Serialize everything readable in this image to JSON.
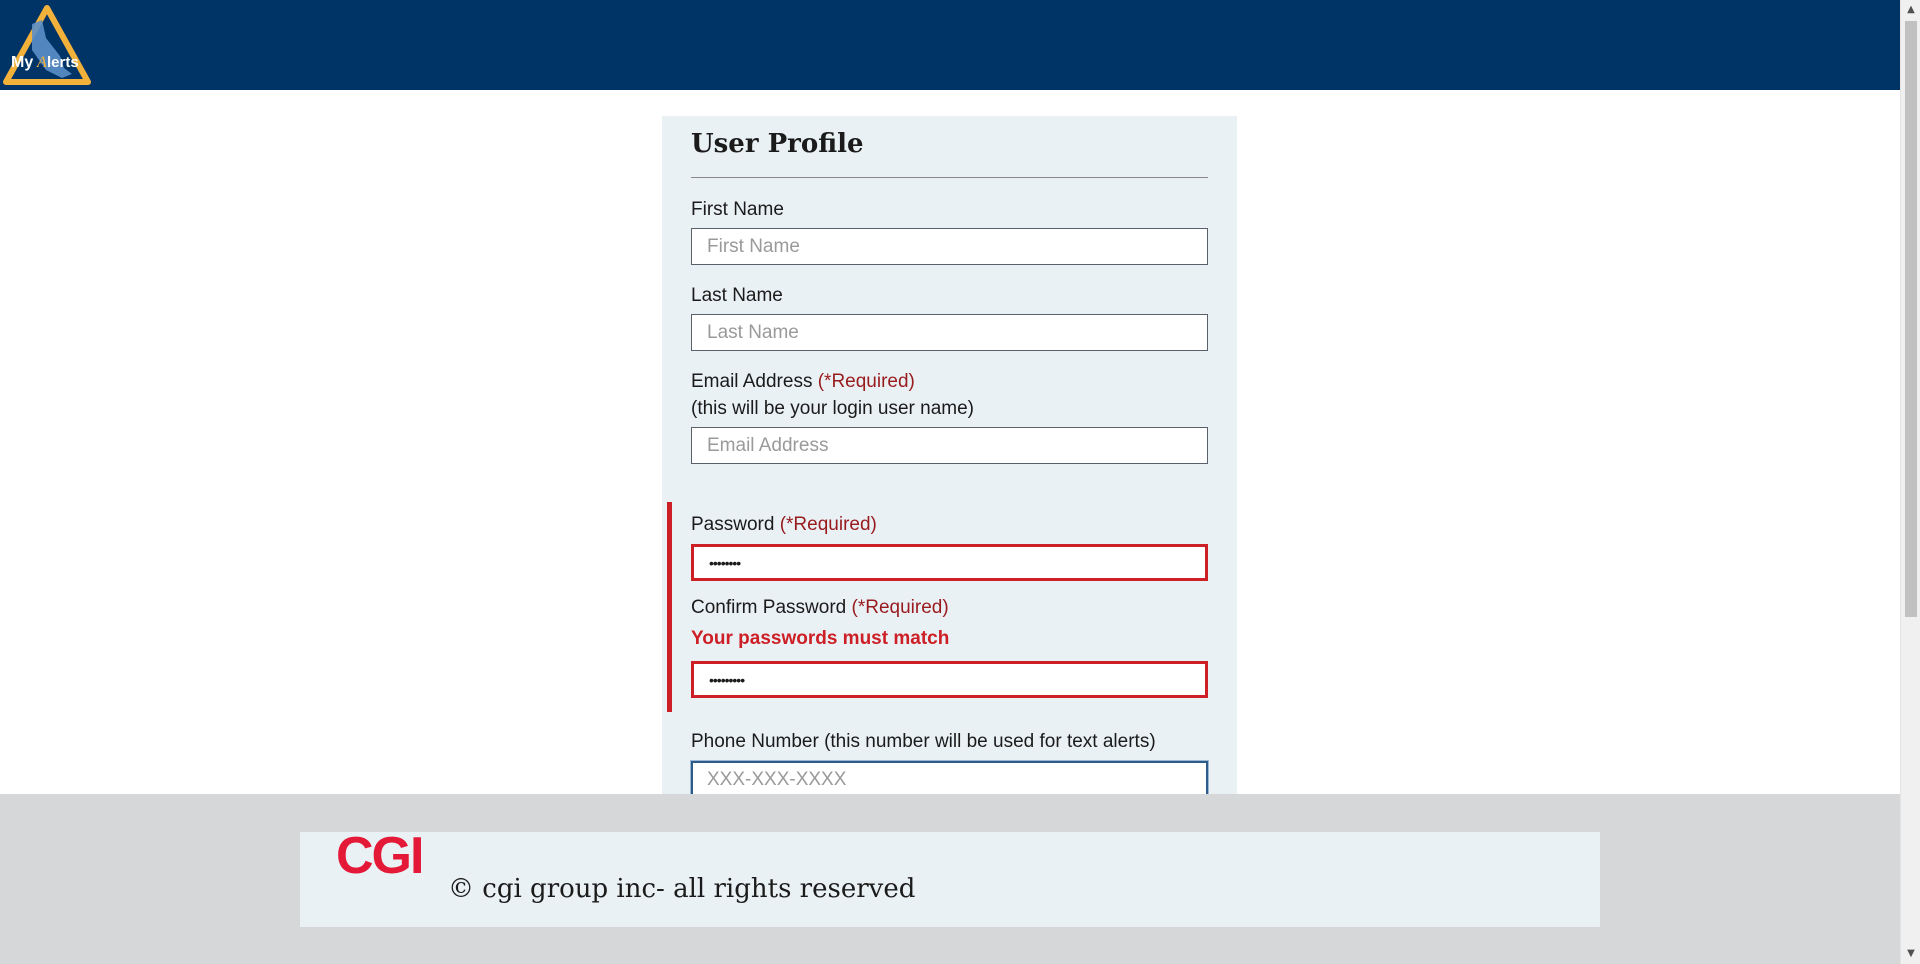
{
  "header": {
    "logo_text": "MyAlerts",
    "logo_icon": "california-triangle-logo"
  },
  "profile": {
    "title": "User Profile",
    "first_name": {
      "label": "First Name",
      "placeholder": "First Name",
      "value": ""
    },
    "last_name": {
      "label": "Last Name",
      "placeholder": "Last Name",
      "value": ""
    },
    "email": {
      "label": "Email Address",
      "required": "(*Required)",
      "hint": "(this will be your login user name)",
      "placeholder": "Email Address",
      "value": ""
    },
    "password": {
      "label": "Password",
      "required": "(*Required)",
      "masked_value": "••••••••"
    },
    "confirm_password": {
      "label": "Confirm Password",
      "required": "(*Required)",
      "error": "Your passwords must match",
      "masked_value": "•••••••••"
    },
    "phone": {
      "label": "Phone Number (this number will be used for text alerts)",
      "placeholder": "XXX-XXX-XXXX",
      "value": ""
    }
  },
  "footer": {
    "brand": "CGI",
    "copyright": "© cgi group inc- all rights reserved"
  },
  "colors": {
    "header_bg": "#003366",
    "panel_bg": "#eaf1f5",
    "error_red": "#cd2026",
    "required_red": "#981b1e",
    "footer_bg": "#d6d7d9",
    "cgi_red": "#e31937",
    "logo_gold": "#f2b13a"
  }
}
